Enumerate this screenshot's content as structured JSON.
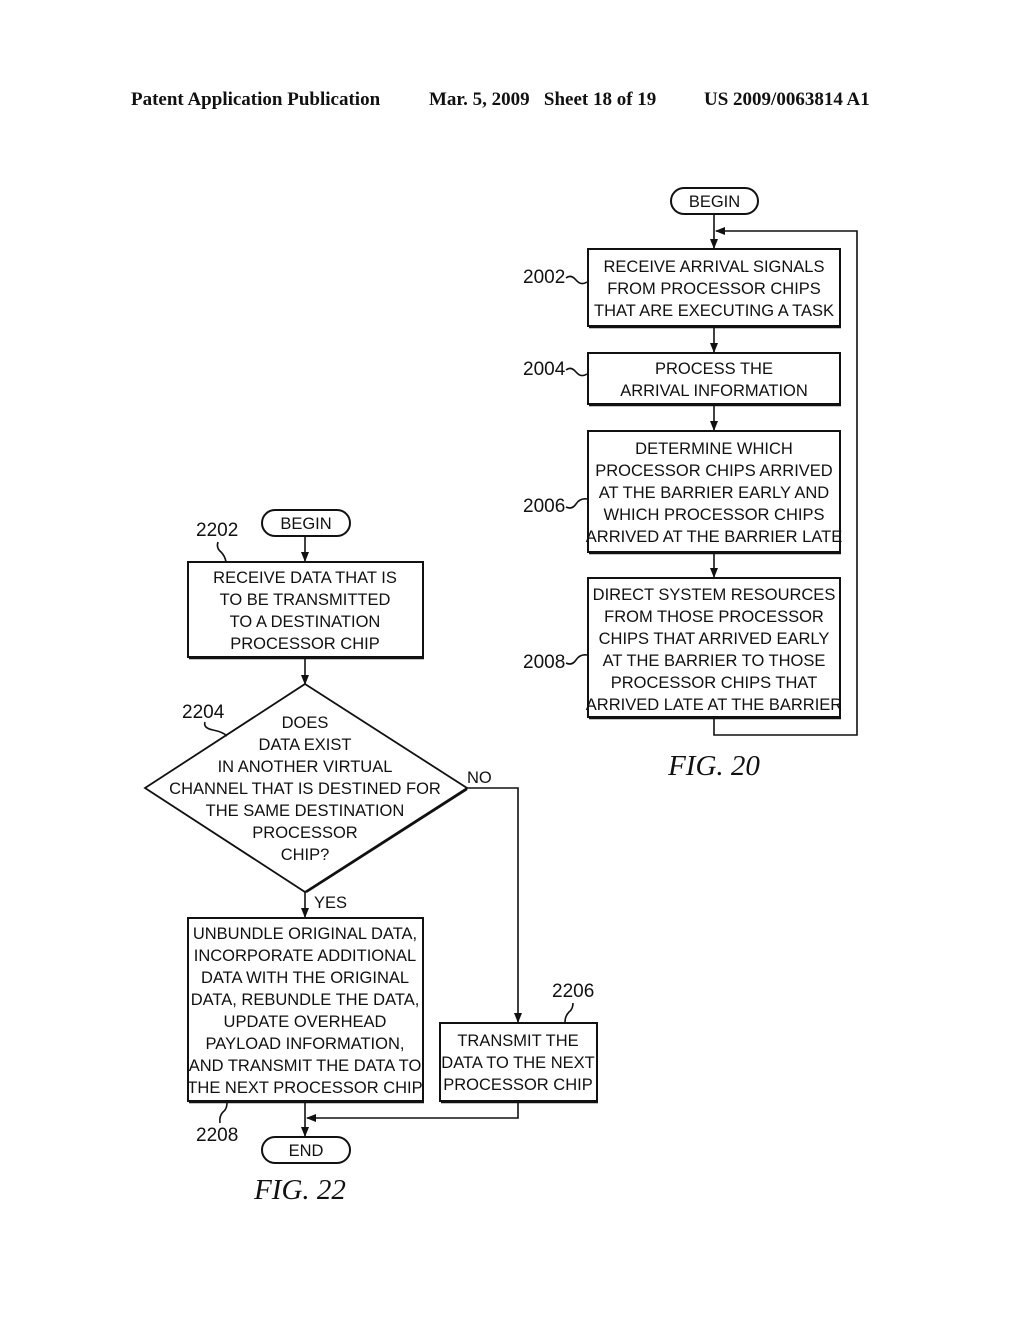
{
  "header": {
    "left": "Patent Application Publication",
    "middle": "Mar. 5, 2009   Sheet 18 of 19",
    "right": "US 2009/0063814 A1"
  },
  "fig20": {
    "caption": "FIG. 20",
    "begin": "BEGIN",
    "steps": [
      {
        "ref": "2002",
        "lines": [
          "RECEIVE ARRIVAL SIGNALS",
          "FROM PROCESSOR CHIPS",
          "THAT ARE EXECUTING A TASK"
        ]
      },
      {
        "ref": "2004",
        "lines": [
          "PROCESS THE",
          "ARRIVAL INFORMATION"
        ]
      },
      {
        "ref": "2006",
        "lines": [
          "DETERMINE WHICH",
          "PROCESSOR CHIPS ARRIVED",
          "AT THE BARRIER EARLY AND",
          "WHICH PROCESSOR CHIPS",
          "ARRIVED AT THE BARRIER LATE"
        ]
      },
      {
        "ref": "2008",
        "lines": [
          "DIRECT SYSTEM RESOURCES",
          "FROM THOSE PROCESSOR",
          "CHIPS THAT ARRIVED EARLY",
          "AT THE BARRIER TO THOSE",
          "PROCESSOR CHIPS THAT",
          "ARRIVED LATE AT THE BARRIER"
        ]
      }
    ]
  },
  "fig22": {
    "caption": "FIG. 22",
    "begin": "BEGIN",
    "end": "END",
    "step_2202": {
      "ref": "2202",
      "lines": [
        "RECEIVE DATA THAT IS",
        "TO BE TRANSMITTED",
        "TO A DESTINATION",
        "PROCESSOR CHIP"
      ]
    },
    "decision_2204": {
      "ref": "2204",
      "lines": [
        "DOES",
        "DATA EXIST",
        "IN ANOTHER VIRTUAL",
        "CHANNEL THAT IS DESTINED FOR",
        "THE SAME DESTINATION",
        "PROCESSOR",
        "CHIP?"
      ],
      "yes_label": "YES",
      "no_label": "NO"
    },
    "step_2206": {
      "ref": "2206",
      "lines": [
        "TRANSMIT THE",
        "DATA TO THE NEXT",
        "PROCESSOR CHIP"
      ]
    },
    "step_2208": {
      "ref": "2208",
      "lines": [
        "UNBUNDLE ORIGINAL DATA,",
        "INCORPORATE ADDITIONAL",
        "DATA WITH THE ORIGINAL",
        "DATA, REBUNDLE THE DATA,",
        "UPDATE OVERHEAD",
        "PAYLOAD INFORMATION,",
        "AND TRANSMIT THE DATA TO",
        "THE NEXT PROCESSOR CHIP"
      ]
    }
  }
}
